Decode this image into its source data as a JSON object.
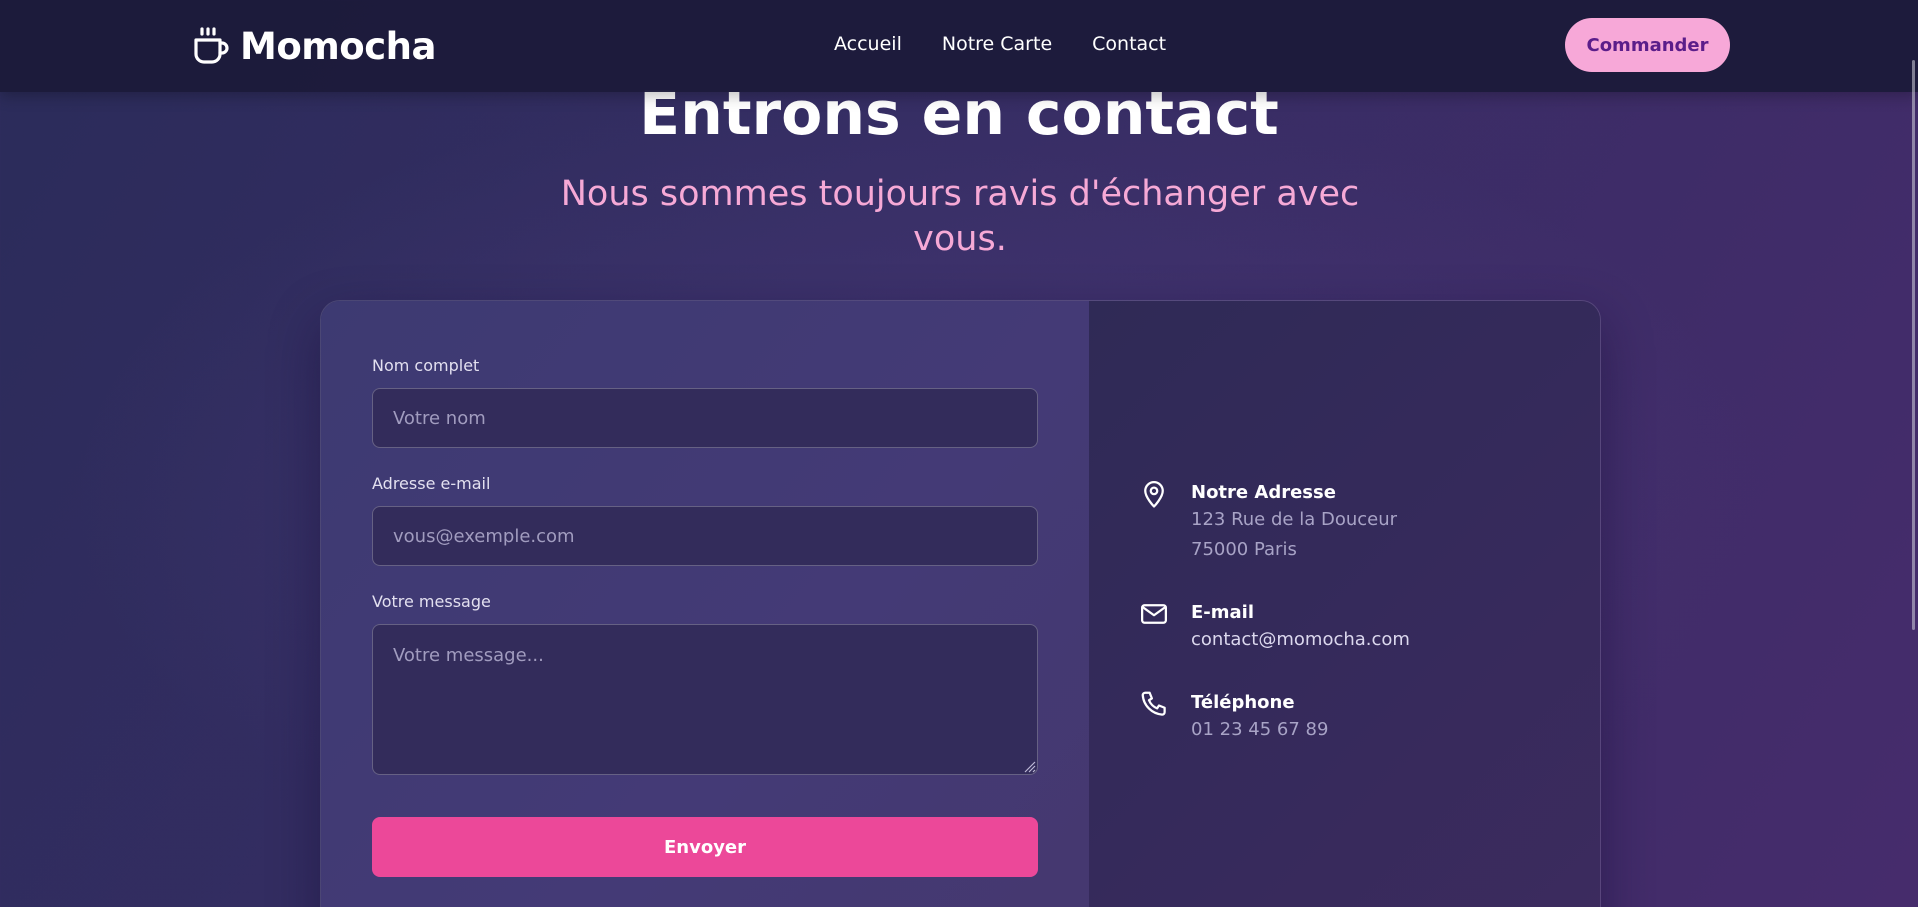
{
  "header": {
    "brand": "Momocha",
    "nav": [
      "Accueil",
      "Notre Carte",
      "Contact"
    ],
    "order_button": "Commander"
  },
  "hero": {
    "title": "Entrons en contact",
    "subtitle": "Nous sommes toujours ravis d'échanger avec vous."
  },
  "form": {
    "name_label": "Nom complet",
    "name_placeholder": "Votre nom",
    "email_label": "Adresse e-mail",
    "email_placeholder": "vous@exemple.com",
    "message_label": "Votre message",
    "message_placeholder": "Votre message...",
    "submit_label": "Envoyer"
  },
  "contact_info": {
    "address": {
      "icon": "map-pin-icon",
      "title": "Notre Adresse",
      "line1": "123 Rue de la Douceur",
      "line2": "75000 Paris"
    },
    "email": {
      "icon": "mail-icon",
      "title": "E-mail",
      "value": "contact@momocha.com"
    },
    "phone": {
      "icon": "phone-icon",
      "title": "Téléphone",
      "value": "01 23 45 67 89"
    }
  },
  "colors": {
    "accent_pink": "#ec4899",
    "soft_pink": "#f6a9d6",
    "order_button_bg": "#f7a8d8",
    "order_button_text": "#5b1d8a",
    "header_bg": "#1c1b3a"
  }
}
